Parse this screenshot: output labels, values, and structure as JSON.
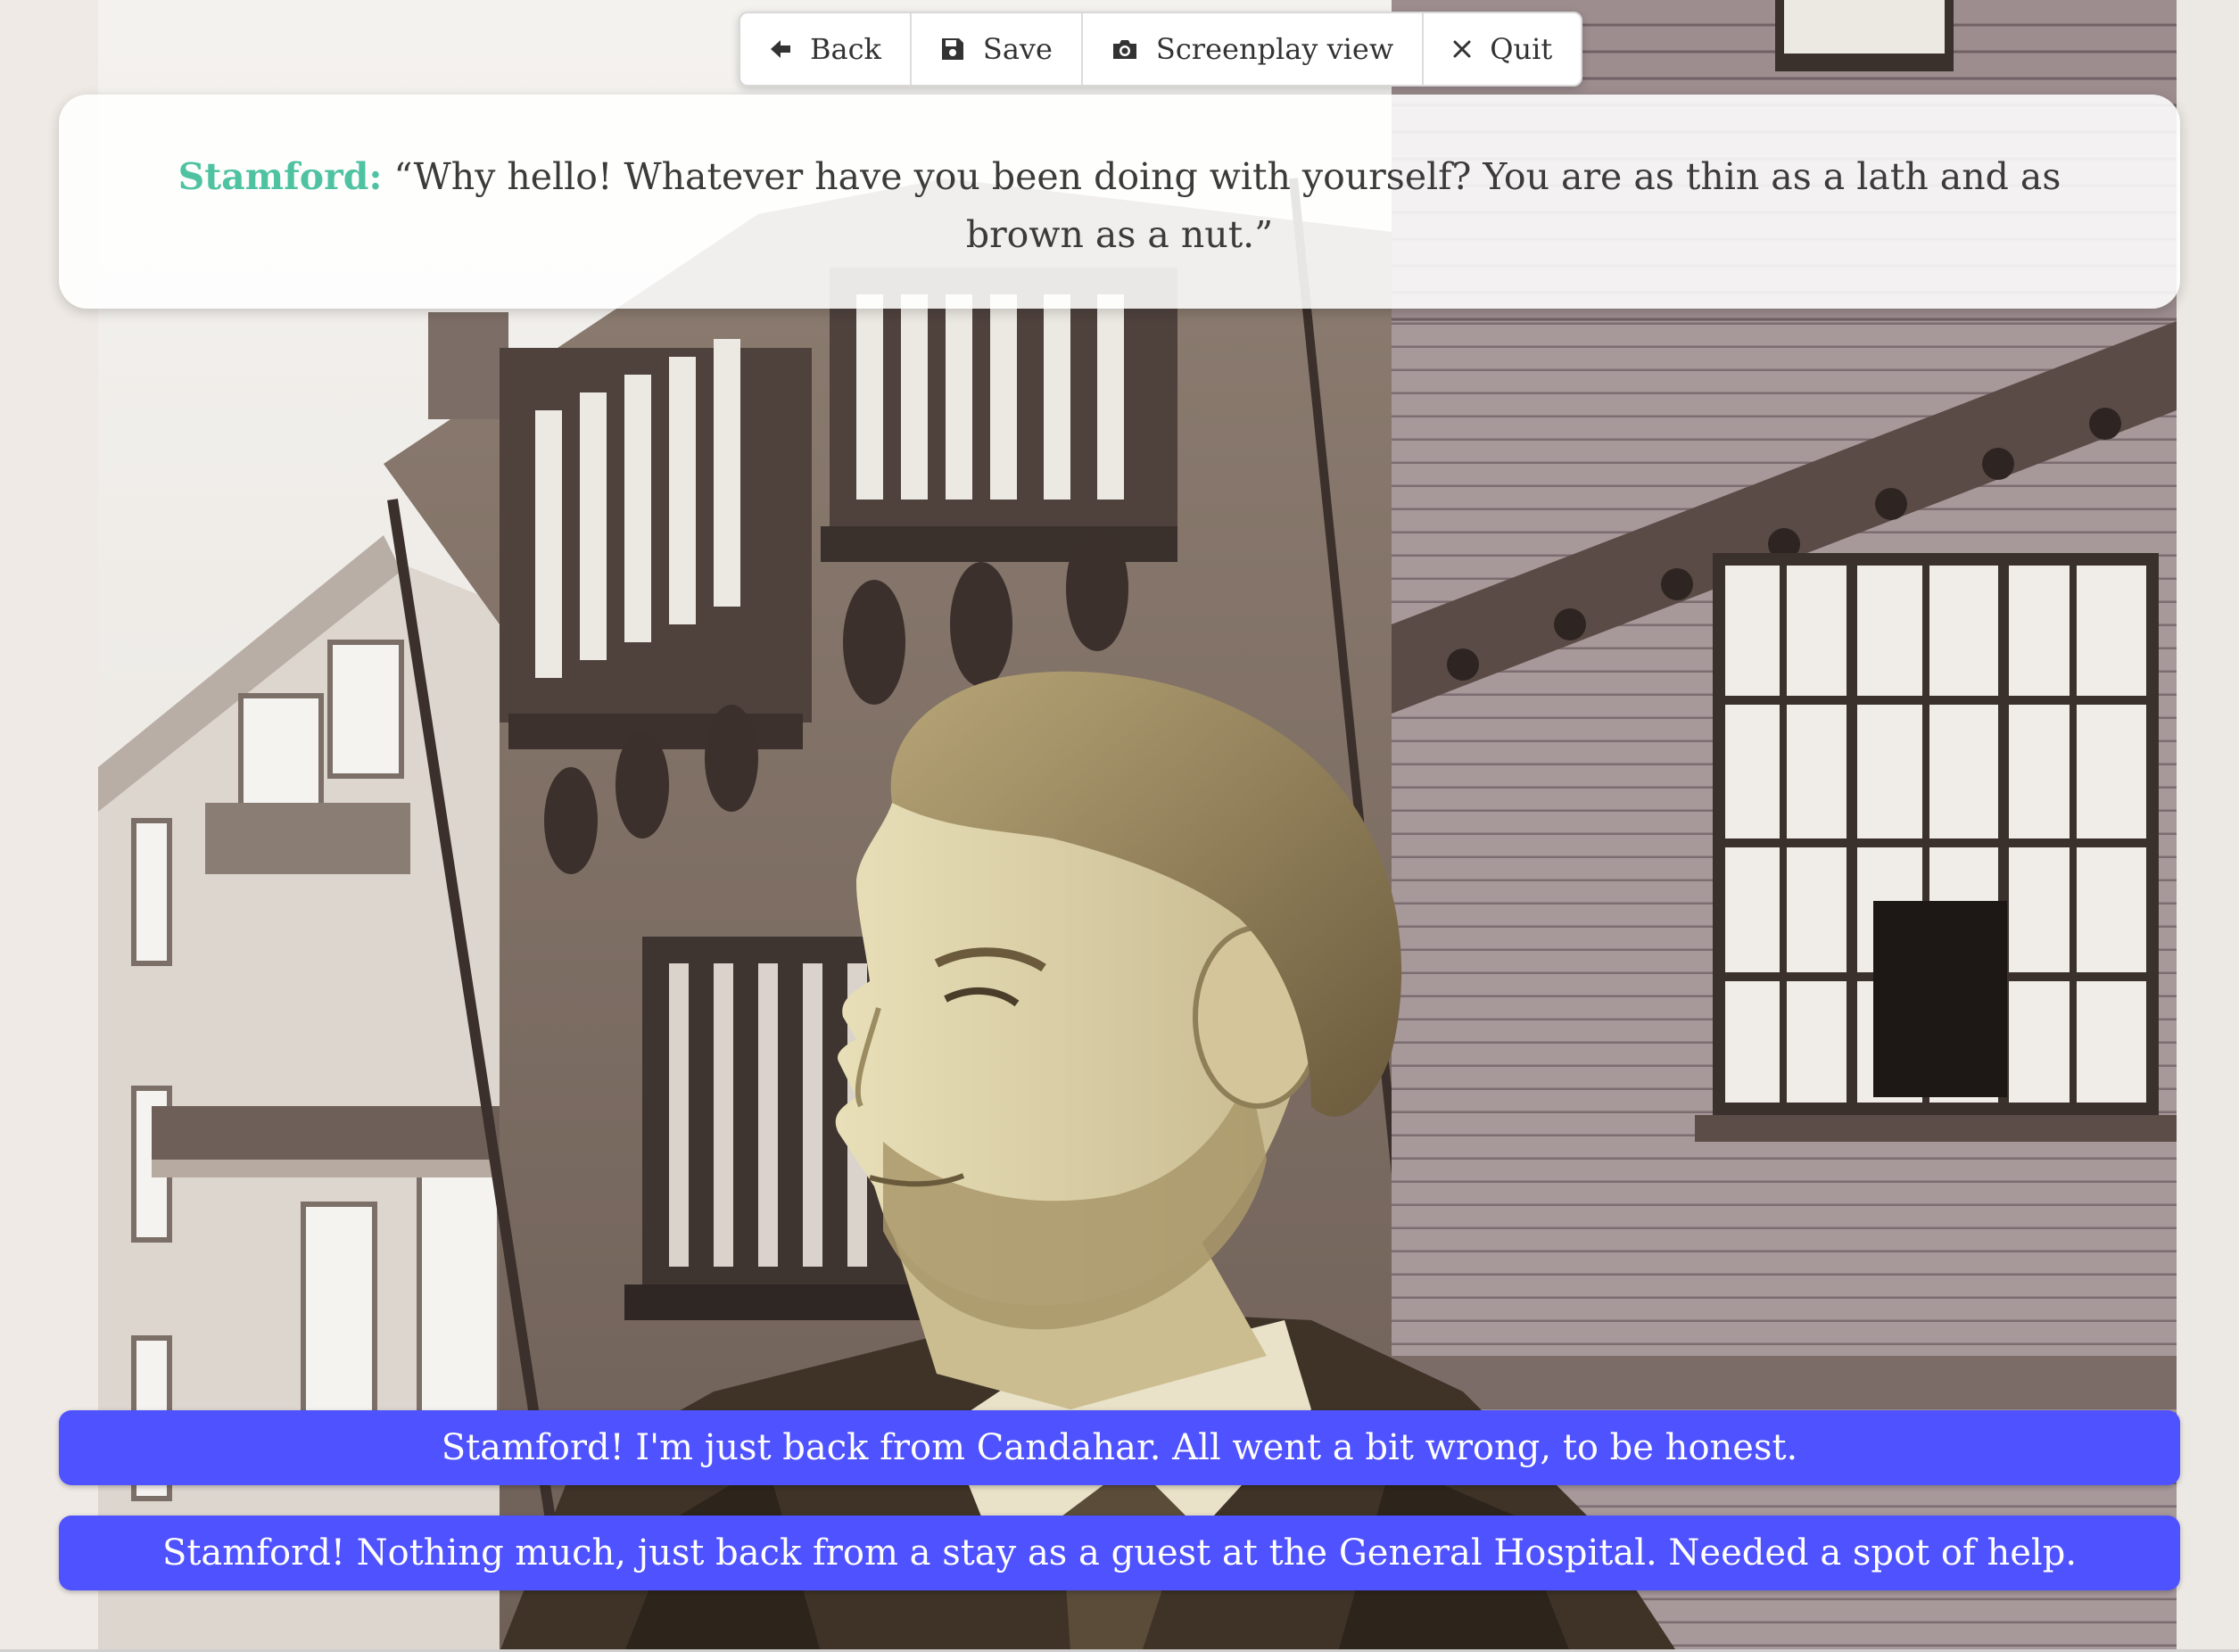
{
  "toolbar": {
    "back": {
      "label": "Back",
      "icon": "arrow-left-icon"
    },
    "save": {
      "label": "Save",
      "icon": "floppy-disk-icon"
    },
    "screenplay": {
      "label": "Screenplay view",
      "icon": "camera-icon"
    },
    "quit": {
      "label": "Quit",
      "icon": "close-icon"
    }
  },
  "dialogue": {
    "speaker": "Stamford:",
    "text": "“Why hello! Whatever have you been doing with yourself? You are as thin as a lath and as brown as a nut.”",
    "speaker_color": "#4fc3a1"
  },
  "choices": [
    {
      "label": "Stamford! I'm just back from Candahar. All went a bit wrong, to be honest."
    },
    {
      "label": "Stamford! Nothing much, just back from a stay as a guest at the General Hospital. Needed a spot of help."
    }
  ],
  "colors": {
    "choice_background": "#4f52ff",
    "choice_text": "#ffffff",
    "dialogue_text": "#3b3b3b"
  }
}
